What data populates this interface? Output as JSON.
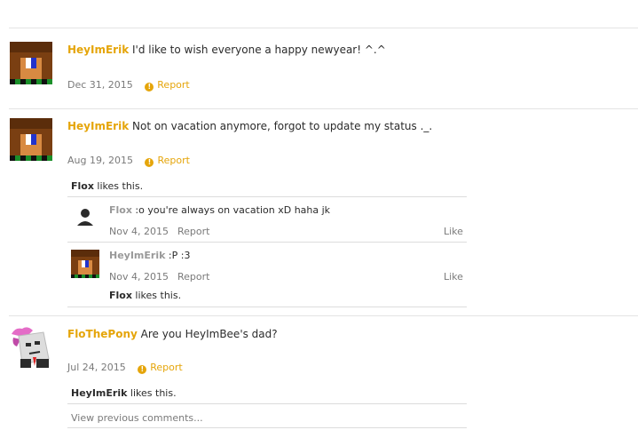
{
  "posts": [
    {
      "user": "HeyImErik",
      "text": " I'd like to wish everyone a happy newyear! ^.^",
      "date": "Dec 31, 2015",
      "report": "Report"
    },
    {
      "user": "HeyImErik",
      "text": " Not on vacation anymore, forgot to update my status ._.",
      "date": "Aug 19, 2015",
      "report": "Report",
      "likes_user": "Flox",
      "likes_text": " likes this.",
      "comments": [
        {
          "user": "Flox",
          "text": " :o you're always on vacation xD haha jk",
          "date": "Nov 4, 2015",
          "report": "Report",
          "like": "Like"
        },
        {
          "user": "HeyImErik",
          "text": " :P :3",
          "date": "Nov 4, 2015",
          "report": "Report",
          "like": "Like",
          "likes_user": "Flox",
          "likes_text": " likes this."
        }
      ]
    },
    {
      "user": "FloThePony",
      "text": " Are you HeyImBee's dad?",
      "date": "Jul 24, 2015",
      "report": "Report",
      "likes_user": "HeyImErik",
      "likes_text": " likes this.",
      "view_previous": "View previous comments..."
    }
  ],
  "colors": {
    "accent": "#e5a50a",
    "muted": "#7a7a7a",
    "divider": "#e3e3e3"
  }
}
